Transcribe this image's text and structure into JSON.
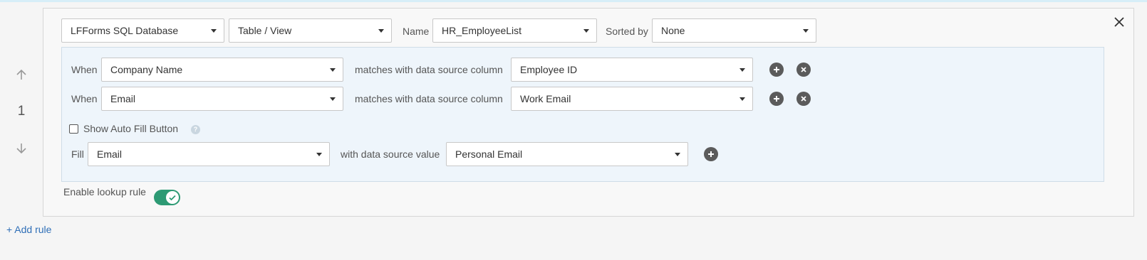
{
  "datasource": {
    "connection": "LFForms SQL Database",
    "type": "Table / View",
    "name_label": "Name",
    "name": "HR_EmployeeList",
    "sorted_by_label": "Sorted by",
    "sorted_by": "None"
  },
  "rule": {
    "number": "1",
    "conditions": [
      {
        "when_label": "When",
        "field": "Company Name",
        "matches_label": "matches with data source column",
        "column": "Employee ID"
      },
      {
        "when_label": "When",
        "field": "Email",
        "matches_label": "matches with data source column",
        "column": "Work Email"
      }
    ],
    "show_autofill": {
      "label": "Show Auto Fill Button",
      "checked": false
    },
    "fill": {
      "fill_label": "Fill",
      "field": "Email",
      "value_label": "with data source value",
      "value": "Personal Email"
    },
    "enable_label": "Enable lookup rule",
    "enabled": true
  },
  "add_rule_label": "+ Add rule",
  "icons": {
    "close": "close-icon",
    "up": "arrow-up-icon",
    "down": "arrow-down-icon",
    "add": "plus-circle-icon",
    "remove": "x-circle-icon",
    "help": "help-icon",
    "check": "check-icon"
  },
  "colors": {
    "toggle_on": "#2d9a74",
    "link": "#2f6fb7",
    "conditions_bg": "#eef5fb",
    "icon_button": "#5b5b5b"
  }
}
